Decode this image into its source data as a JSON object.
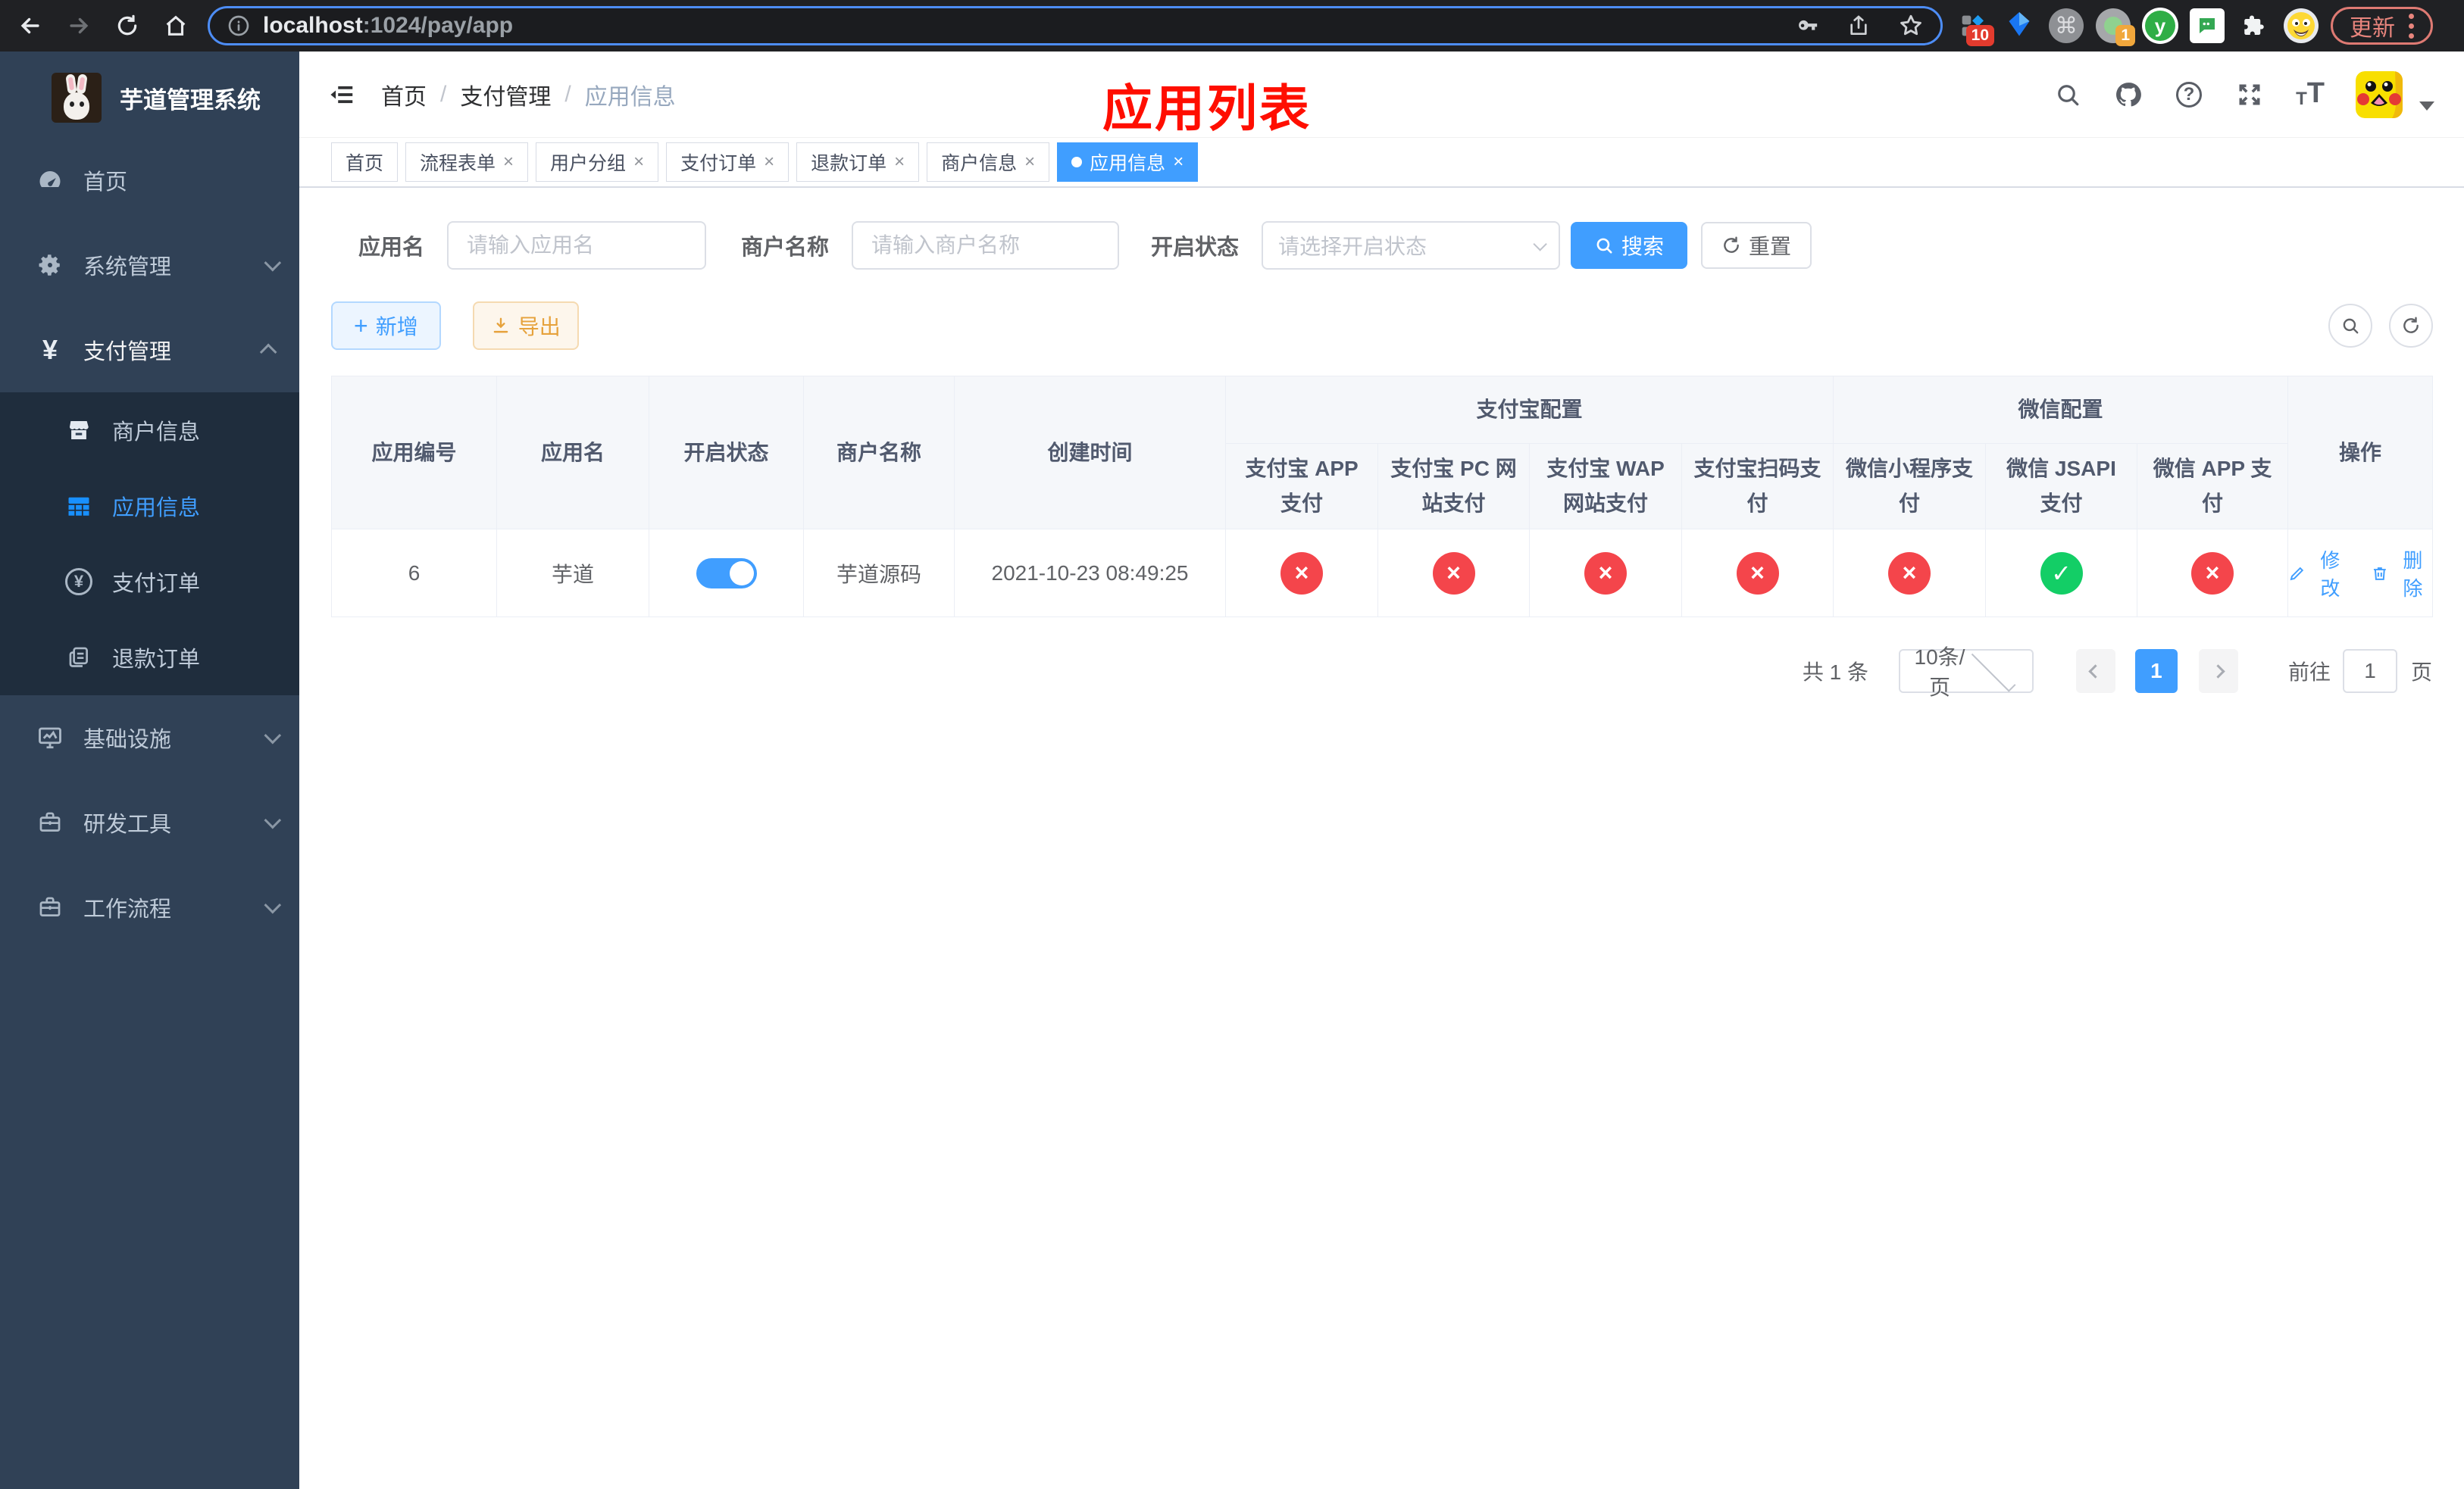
{
  "browser": {
    "url_host": "localhost",
    "url_path": ":1024/pay/app",
    "update_label": "更新",
    "extension_badge_red": "10",
    "extension_badge_orange": "1",
    "extension_letter": "y"
  },
  "header": {
    "breadcrumb": [
      "首页",
      "支付管理",
      "应用信息"
    ],
    "separator": "/",
    "page_title": "应用列表"
  },
  "sidebar": {
    "app_title": "芋道管理系统",
    "menu": [
      {
        "label": "首页"
      },
      {
        "label": "系统管理"
      },
      {
        "label": "支付管理"
      },
      {
        "label": "商户信息"
      },
      {
        "label": "应用信息"
      },
      {
        "label": "支付订单"
      },
      {
        "label": "退款订单"
      },
      {
        "label": "基础设施"
      },
      {
        "label": "研发工具"
      },
      {
        "label": "工作流程"
      }
    ]
  },
  "tabbar": {
    "tabs": [
      {
        "label": "首页"
      },
      {
        "label": "流程表单"
      },
      {
        "label": "用户分组"
      },
      {
        "label": "支付订单"
      },
      {
        "label": "退款订单"
      },
      {
        "label": "商户信息"
      },
      {
        "label": "应用信息"
      }
    ]
  },
  "search": {
    "app_name_label": "应用名",
    "app_name_placeholder": "请输入应用名",
    "merchant_label": "商户名称",
    "merchant_placeholder": "请输入商户名称",
    "status_label": "开启状态",
    "status_placeholder": "请选择开启状态",
    "search_label": "搜索",
    "reset_label": "重置"
  },
  "toolbar": {
    "add_label": "新增",
    "export_label": "导出"
  },
  "table": {
    "headers": {
      "app_id": "应用编号",
      "app_name": "应用名",
      "status": "开启状态",
      "merchant": "商户名称",
      "created": "创建时间",
      "group_alipay": "支付宝配置",
      "group_wechat": "微信配置",
      "sub": [
        "支付宝 APP 支付",
        "支付宝 PC 网站支付",
        "支付宝 WAP 网站支付",
        "支付宝扫码支付",
        "微信小程序支付",
        "微信 JSAPI 支付",
        "微信 APP 支付"
      ],
      "op": "操作"
    },
    "row": {
      "id": "6",
      "name": "芋道",
      "status": "on",
      "merchant": "芋道源码",
      "created": "2021-10-23 08:49:25",
      "channels": [
        {
          "name": "alipay-app",
          "state": "closed",
          "glyph": "×"
        },
        {
          "name": "alipay-pc",
          "state": "closed",
          "glyph": "×"
        },
        {
          "name": "alipay-wap",
          "state": "closed",
          "glyph": "×"
        },
        {
          "name": "alipay-qr",
          "state": "closed",
          "glyph": "×"
        },
        {
          "name": "wechat-mini",
          "state": "closed",
          "glyph": "×"
        },
        {
          "name": "wechat-jsapi",
          "state": "open",
          "glyph": "✓"
        },
        {
          "name": "wechat-app",
          "state": "closed",
          "glyph": "×"
        }
      ]
    },
    "actions": {
      "edit": "修改",
      "delete": "删除"
    }
  },
  "pagination": {
    "total": "共 1 条",
    "page_size": "10条/页",
    "page": "1",
    "goto_label": "前往",
    "goto_value": "1",
    "page_suffix": "页"
  },
  "icons": {
    "close": "×",
    "plus": "+",
    "question": "?",
    "yen": "¥",
    "cmd": "⌘",
    "font_small": "T",
    "font_big": "T"
  },
  "colors": {
    "accent": "#409eff",
    "danger": "#f4454b",
    "success": "#13ce66",
    "warning": "#e6a23c",
    "sidebar_bg": "#304156",
    "submenu_bg": "#1f2d3d",
    "title_red": "#ff0e00"
  }
}
